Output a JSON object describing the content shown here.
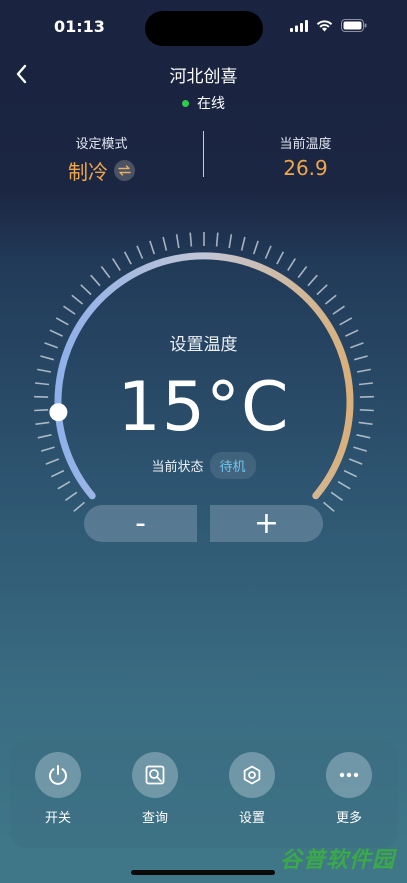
{
  "status_bar": {
    "time": "01:13"
  },
  "header": {
    "title": "河北创喜",
    "online_text": "在线"
  },
  "info": {
    "mode_label": "设定模式",
    "mode_value": "制冷",
    "current_temp_label": "当前温度",
    "current_temp_value": "26.9"
  },
  "dial": {
    "set_label": "设置温度",
    "temperature": "15°C",
    "state_label": "当前状态",
    "state_value": "待机"
  },
  "stepper": {
    "minus_label": "-",
    "plus_label": "+"
  },
  "bottom": {
    "items": [
      {
        "label": "开关",
        "icon": "power-icon"
      },
      {
        "label": "查询",
        "icon": "search-doc-icon"
      },
      {
        "label": "设置",
        "icon": "settings-hex-icon"
      },
      {
        "label": "更多",
        "icon": "more-dots-icon"
      }
    ]
  },
  "watermark": {
    "text": "谷普软件园"
  },
  "colors": {
    "accent_orange": "#f0a64a",
    "online_green": "#2ecc4a",
    "badge_blue": "#6fc7f0",
    "dial_cool": "#8fb0ea",
    "dial_warm": "#d9b07a"
  }
}
